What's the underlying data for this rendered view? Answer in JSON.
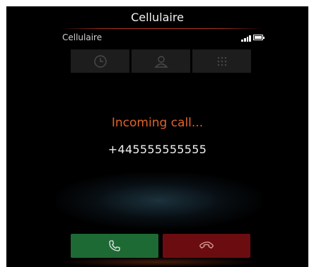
{
  "header": {
    "title": "Cellulaire"
  },
  "status": {
    "label": "Cellulaire",
    "signal_icon": "signal-strength-icon",
    "battery_icon": "battery-icon"
  },
  "tabs": [
    {
      "name": "recent-calls",
      "icon": "clock-icon"
    },
    {
      "name": "contacts",
      "icon": "person-icon"
    },
    {
      "name": "keypad",
      "icon": "dialpad-icon"
    }
  ],
  "call": {
    "status_text": "Incoming call...",
    "number": "+445555555555"
  },
  "actions": {
    "accept_icon": "phone-accept-icon",
    "decline_icon": "phone-decline-icon"
  },
  "colors": {
    "accent": "#e0632a",
    "accept": "#1e6a34",
    "decline": "#6b0d10",
    "background": "#000000"
  }
}
